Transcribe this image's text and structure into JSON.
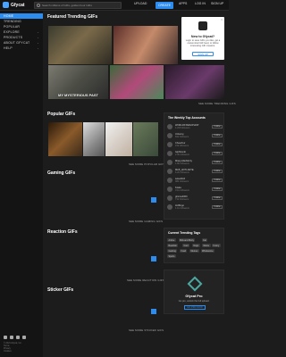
{
  "header": {
    "logo_text": "Gfycat",
    "search_placeholder": "Search millions of GIFs, golden hour GIFs",
    "tabs": [
      "UPLOAD",
      "CREATE"
    ],
    "login": "LOG IN",
    "signup": "SIGN UP",
    "apps": "APPS"
  },
  "sidebar": {
    "items": [
      {
        "label": "HOME",
        "has_chevron": false
      },
      {
        "label": "TRENDING",
        "has_chevron": false
      },
      {
        "label": "POPULAR",
        "has_chevron": false
      },
      {
        "label": "EXPLORE",
        "has_chevron": true
      },
      {
        "label": "PRODUCTS",
        "has_chevron": true
      },
      {
        "label": "ABOUT GFYCAT",
        "has_chevron": true
      },
      {
        "label": "HELP",
        "has_chevron": true
      }
    ],
    "footer": {
      "legal": [
        "© 2021 Gfycat, Inc.",
        "Terms",
        "Privacy",
        "Cookies"
      ]
    }
  },
  "sections": {
    "featured": {
      "title": "Featured Trending GIFs",
      "see_more": "SEE MORE TRENDING GIFS",
      "caption": "MY MYSTERIOUS PAST"
    },
    "popular": {
      "title": "Popular GIFs",
      "see_more": "SEE MORE POPULAR GIFS"
    },
    "gaming": {
      "title": "Gaming GIFs",
      "see_more": "SEE MORE GAMING GIFS"
    },
    "reaction": {
      "title": "Reaction GIFs",
      "see_more": "SEE MORE REACTION GIFS"
    },
    "sticker": {
      "title": "Sticker GIFs",
      "see_more": "SEE MORE STICKER GIFS"
    }
  },
  "popup": {
    "title": "New to Gfycat?",
    "body": "Login to save GIFs you like, get a customized GIF feed, or follow interesting GIF creators.",
    "button": "SIGN UP",
    "close": "×"
  },
  "top_accounts": {
    "title": "The Weekly Top Accounts",
    "follow_label": "Follow",
    "accounts": [
      {
        "name": "WORLDSTARHIPHOP",
        "sub": "1.2M followers"
      },
      {
        "name": "Unfunny",
        "sub": "842 followers"
      },
      {
        "name": "Cheezbur",
        "sub": "15k followers"
      },
      {
        "name": "Giphbomb",
        "sub": "2.3k followers"
      },
      {
        "name": "Missy-MacMorty",
        "sub": "1.8k followers"
      },
      {
        "name": "MLB_HOTLANTE",
        "sub": "6.2k followers"
      },
      {
        "name": "sweetbird",
        "sub": "984 followers"
      },
      {
        "name": "Koala",
        "sub": "3.1k followers"
      },
      {
        "name": "gimme2000",
        "sub": "712 followers"
      },
      {
        "name": "Hi-Bingo",
        "sub": "1.1k followers"
      }
    ]
  },
  "trending_tags": {
    "title": "Current Trending Tags",
    "tags": [
      "Anime",
      "Rick and Morty",
      "Cat",
      "Reaction",
      "Cool",
      "Dogs",
      "Meme",
      "Funny",
      "Gaming",
      "Food",
      "Memes",
      "Wholesome",
      "Sports"
    ]
  },
  "pro": {
    "title": "Gfycat Pro",
    "body": "Go pro, unlock the full upload.",
    "button": "GO PRO NOW"
  },
  "colors": {
    "accent": "#2d8cf0",
    "bg": "#1c1c1c",
    "sidebar": "#141414"
  }
}
